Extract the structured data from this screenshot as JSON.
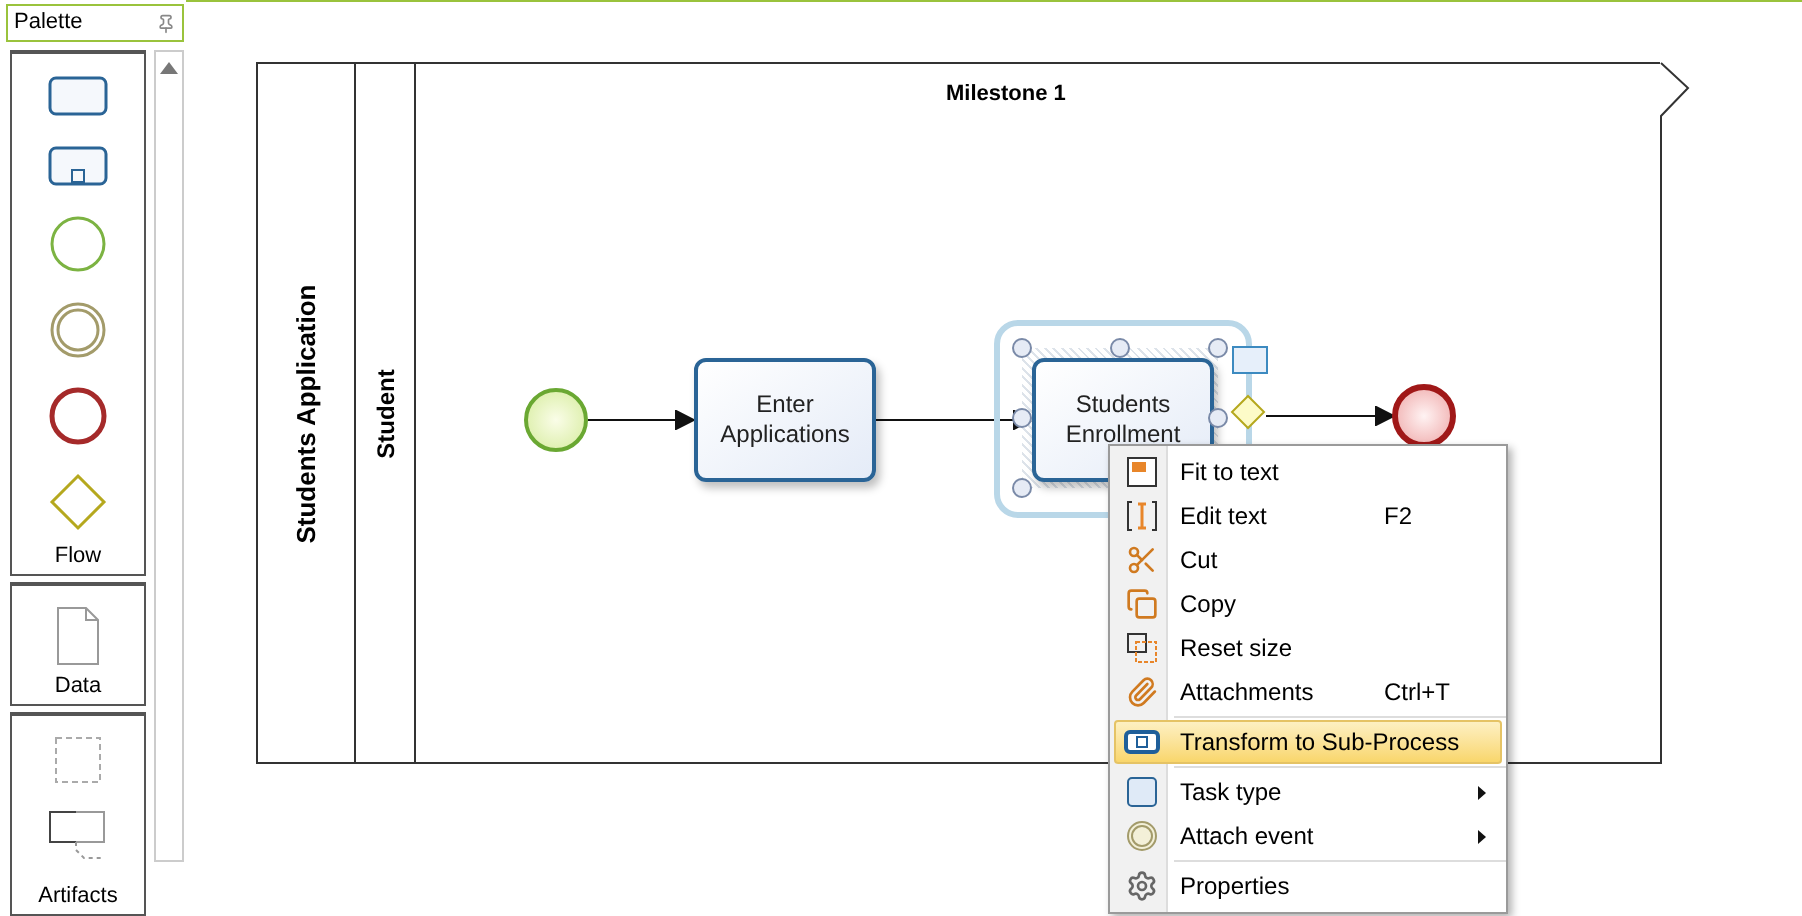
{
  "palette": {
    "title": "Palette",
    "sections": [
      {
        "label": "Flow"
      },
      {
        "label": "Data"
      },
      {
        "label": "Artifacts"
      }
    ]
  },
  "pool": {
    "title": "Students Application",
    "lane": "Student",
    "milestone": "Milestone 1"
  },
  "tasks": [
    {
      "lines": [
        "Enter",
        "Applications"
      ],
      "selected": false
    },
    {
      "lines": [
        "Students",
        "Enrollment"
      ],
      "selected": true
    }
  ],
  "context_menu": {
    "groups": [
      [
        {
          "label": "Fit to text",
          "selected": false,
          "submenu": false
        },
        {
          "label": "Edit text",
          "shortcut": "F2",
          "selected": false,
          "submenu": false
        },
        {
          "label": "Cut",
          "selected": false,
          "submenu": false
        },
        {
          "label": "Copy",
          "selected": false,
          "submenu": false
        },
        {
          "label": "Reset size",
          "selected": false,
          "submenu": false
        },
        {
          "label": "Attachments",
          "shortcut": "Ctrl+T",
          "selected": false,
          "submenu": false
        }
      ],
      [
        {
          "label": "Transform to Sub-Process",
          "selected": true,
          "submenu": false
        }
      ],
      [
        {
          "label": "Task type",
          "selected": false,
          "submenu": true
        },
        {
          "label": "Attach event",
          "selected": false,
          "submenu": true
        }
      ],
      [
        {
          "label": "Properties",
          "selected": false,
          "submenu": false
        }
      ]
    ]
  }
}
